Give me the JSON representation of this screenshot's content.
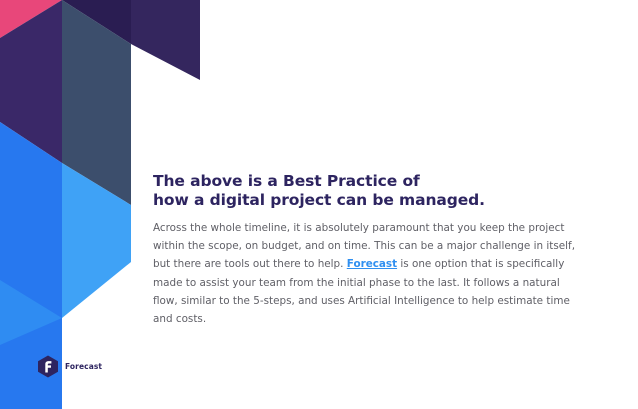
{
  "decor": {
    "colors": {
      "pink": "#e8477a",
      "purple_dark": "#3a2868",
      "purple_deeper": "#2a1d52",
      "slate": "#3c4e6c",
      "navy_right": "#34265e",
      "blue_bright": "#2778ef",
      "blue_light": "#3fa2f6",
      "blue_mid": "#2f8cf2"
    }
  },
  "content": {
    "heading_lines": [
      "The above is a Best Practice of",
      "how a digital project can be managed."
    ],
    "body": {
      "line1": "Across the whole timeline, it is absolutely paramount that you keep the project",
      "line2": "within the scope, on budget, and on time. This can be a major challenge in itself,",
      "line3_before": "but there are tools out there to help. ",
      "link_text": "Forecast",
      "line3_after": " is one option that is specifically",
      "line4": "made to assist your team from the initial phase to the last. It follows a natural",
      "line5": "flow, similar to the 5-steps, and uses Artificial Intelligence to help estimate time",
      "line6": "and costs."
    },
    "colors": {
      "heading": "#2d2460",
      "body": "#5f5f66",
      "link": "#2f8ff0"
    }
  },
  "footer": {
    "brand_name": "Forecast",
    "logo_icon": "forecast-hexagon-logo-icon",
    "logo_color": "#2d2460"
  }
}
